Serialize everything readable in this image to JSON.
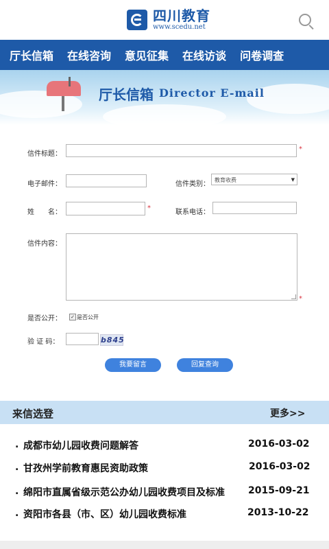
{
  "header": {
    "logo_title": "四川教育",
    "logo_url": "www.scedu.net"
  },
  "nav": {
    "items": [
      "厅长信箱",
      "在线咨询",
      "意见征集",
      "在线访谈",
      "问卷调查"
    ]
  },
  "banner": {
    "title": "厅长信箱",
    "subtitle": "Director E-mail"
  },
  "form": {
    "subject_label": "信件标题：",
    "email_label": "电子邮件：",
    "category_label": "信件类别：",
    "category_value": "教育收费",
    "name_label": "姓　　名：",
    "phone_label": "联系电话：",
    "content_label": "信件内容：",
    "public_label": "是否公开：",
    "public_checkbox_label": "是否公开",
    "captcha_label": "验 证 码：",
    "captcha_text": "b845",
    "required_mark": "*",
    "submit_label": "我要留言",
    "query_label": "回复查询"
  },
  "letters": {
    "title": "来信选登",
    "more": "更多>>",
    "items": [
      {
        "title": "成都市幼儿园收费问题解答",
        "date": "2016-03-02"
      },
      {
        "title": "甘孜州学前教育惠民资助政策",
        "date": "2016-03-02"
      },
      {
        "title": "绵阳市直属省级示范公办幼儿园收费项目及标准",
        "date": "2015-09-21"
      },
      {
        "title": "资阳市各县（市、区）幼儿园收费标准",
        "date": "2013-10-22"
      }
    ]
  },
  "colors": {
    "brand": "#1e5aa8",
    "button": "#3f82de",
    "section_bg": "#c8e0f4",
    "required": "#d9333f"
  }
}
